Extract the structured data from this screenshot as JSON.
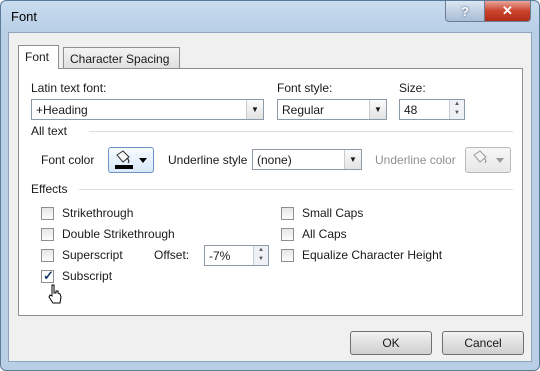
{
  "window": {
    "title": "Font",
    "help_glyph": "?",
    "close_glyph": "✕"
  },
  "tabs": [
    {
      "label": "Font",
      "active": true
    },
    {
      "label": "Character Spacing",
      "active": false
    }
  ],
  "font_section": {
    "latin_label": "Latin text font:",
    "latin_value": "+Heading",
    "style_label": "Font style:",
    "style_value": "Regular",
    "size_label": "Size:",
    "size_value": "48"
  },
  "all_text": {
    "heading": "All text",
    "font_color_label": "Font color",
    "underline_style_label": "Underline style",
    "underline_style_value": "(none)",
    "underline_color_label": "Underline color"
  },
  "effects": {
    "heading": "Effects",
    "left": [
      {
        "label": "Strikethrough",
        "checked": false
      },
      {
        "label": "Double Strikethrough",
        "checked": false
      },
      {
        "label": "Superscript",
        "checked": false
      },
      {
        "label": "Subscript",
        "checked": true
      }
    ],
    "right": [
      {
        "label": "Small Caps",
        "checked": false
      },
      {
        "label": "All Caps",
        "checked": false
      },
      {
        "label": "Equalize Character Height",
        "checked": false
      }
    ],
    "offset_label": "Offset:",
    "offset_value": "-7%"
  },
  "buttons": {
    "ok": "OK",
    "cancel": "Cancel"
  },
  "colors": {
    "font_color_swatch": "#000000",
    "accent_border": "#6d92c6"
  }
}
